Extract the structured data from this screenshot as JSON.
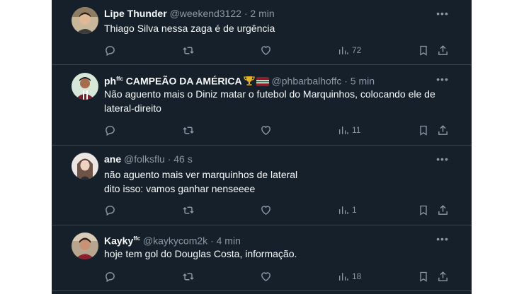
{
  "tweets": [
    {
      "name": "Lipe Thunder",
      "badge": "",
      "handle": "@weekend3122",
      "time": "· 2 min",
      "text_lines": [
        "Thiago Silva nessa zaga é de urgência"
      ],
      "views": "72"
    },
    {
      "name": "ph",
      "badge": "ffc",
      "name_suffix": "CAMPEÃO DA AMÉRICA",
      "handle": "@phbarbalhoffc",
      "time": "· 5 min",
      "text_lines": [
        "Não aguento mais o Diniz matar o futebol do Marquinhos, colocando ele de",
        "lateral-direito"
      ],
      "views": "11"
    },
    {
      "name": "ane",
      "badge": "",
      "handle": "@folksflu",
      "time": "· 46 s",
      "text_lines": [
        "não aguento mais ver marquinhos de lateral",
        "dito isso: vamos ganhar nenseeee"
      ],
      "views": "1"
    },
    {
      "name": "Kayky",
      "badge": "ffc",
      "handle": "@kaykycom2k",
      "time": "· 4 min",
      "text_lines": [
        "hoje tem gol do Douglas Costa, informação."
      ],
      "views": "18"
    }
  ],
  "icons": {
    "reply": "reply-icon",
    "retweet": "retweet-icon",
    "like": "heart-icon",
    "views": "views-icon",
    "bookmark": "bookmark-icon",
    "share": "share-icon",
    "more": "more-icon"
  },
  "colors": {
    "background": "#15202b",
    "text": "#f7f9f9",
    "muted": "#8b98a5",
    "divider": "#38444d"
  }
}
